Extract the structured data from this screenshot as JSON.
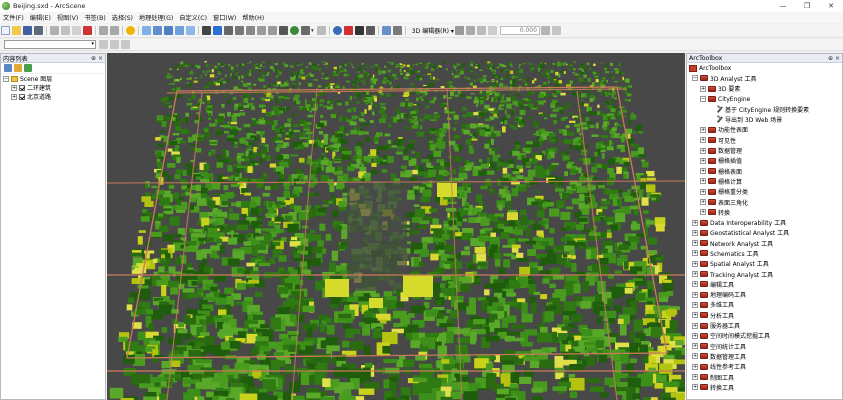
{
  "window": {
    "title": "Beijing.sxd - ArcScene",
    "controls": [
      "—",
      "❒",
      "✕"
    ]
  },
  "menu": [
    "文件(F)",
    "编辑(E)",
    "视图(V)",
    "书签(B)",
    "选择(S)",
    "地理处理(G)",
    "自定义(C)",
    "窗口(W)",
    "帮助(H)"
  ],
  "toolbar": {
    "editor_label": "3D 编辑器(R) ▾",
    "zoom_value": "0.000"
  },
  "toc": {
    "title": "内容列表",
    "controls": "⊕ ×",
    "layers_root": "Scene 图层",
    "layers": [
      "二环建筑",
      "北京道路"
    ]
  },
  "toolbox": {
    "title": "ArcToolbox",
    "controls": "⊕ ×",
    "root": "ArcToolbox",
    "items": [
      {
        "label": "3D Analyst 工具",
        "level": 0,
        "expander": "−",
        "icon": "toolbox"
      },
      {
        "label": "3D 要素",
        "level": 1,
        "expander": "+",
        "icon": "toolbox"
      },
      {
        "label": "CityEngine",
        "level": 1,
        "expander": "−",
        "icon": "toolbox"
      },
      {
        "label": "基于 CityEngine 规则转换要素",
        "level": 2,
        "expander": "",
        "icon": "tool"
      },
      {
        "label": "导出到 3D Web 场景",
        "level": 2,
        "expander": "",
        "icon": "tool"
      },
      {
        "label": "功能性表面",
        "level": 1,
        "expander": "+",
        "icon": "toolbox"
      },
      {
        "label": "可见性",
        "level": 1,
        "expander": "+",
        "icon": "toolbox"
      },
      {
        "label": "数据管理",
        "level": 1,
        "expander": "+",
        "icon": "toolbox"
      },
      {
        "label": "栅格插值",
        "level": 1,
        "expander": "+",
        "icon": "toolbox"
      },
      {
        "label": "栅格表面",
        "level": 1,
        "expander": "+",
        "icon": "toolbox"
      },
      {
        "label": "栅格计算",
        "level": 1,
        "expander": "+",
        "icon": "toolbox"
      },
      {
        "label": "栅格重分类",
        "level": 1,
        "expander": "+",
        "icon": "toolbox"
      },
      {
        "label": "表面三角化",
        "level": 1,
        "expander": "+",
        "icon": "toolbox"
      },
      {
        "label": "转换",
        "level": 1,
        "expander": "+",
        "icon": "toolbox"
      },
      {
        "label": "Data Interoperability 工具",
        "level": 0,
        "expander": "+",
        "icon": "toolbox"
      },
      {
        "label": "Geostatistical Analyst 工具",
        "level": 0,
        "expander": "+",
        "icon": "toolbox"
      },
      {
        "label": "Network Analyst 工具",
        "level": 0,
        "expander": "+",
        "icon": "toolbox"
      },
      {
        "label": "Schematics 工具",
        "level": 0,
        "expander": "+",
        "icon": "toolbox"
      },
      {
        "label": "Spatial Analyst 工具",
        "level": 0,
        "expander": "+",
        "icon": "toolbox"
      },
      {
        "label": "Tracking Analyst 工具",
        "level": 0,
        "expander": "+",
        "icon": "toolbox"
      },
      {
        "label": "编辑工具",
        "level": 0,
        "expander": "+",
        "icon": "toolbox"
      },
      {
        "label": "地理编码工具",
        "level": 0,
        "expander": "+",
        "icon": "toolbox"
      },
      {
        "label": "多维工具",
        "level": 0,
        "expander": "+",
        "icon": "toolbox"
      },
      {
        "label": "分析工具",
        "level": 0,
        "expander": "+",
        "icon": "toolbox"
      },
      {
        "label": "服务器工具",
        "level": 0,
        "expander": "+",
        "icon": "toolbox"
      },
      {
        "label": "空间时间模式挖掘工具",
        "level": 0,
        "expander": "+",
        "icon": "toolbox"
      },
      {
        "label": "空间统计工具",
        "level": 0,
        "expander": "+",
        "icon": "toolbox"
      },
      {
        "label": "数据管理工具",
        "level": 0,
        "expander": "+",
        "icon": "toolbox"
      },
      {
        "label": "线性参考工具",
        "level": 0,
        "expander": "+",
        "icon": "toolbox"
      },
      {
        "label": "制图工具",
        "level": 0,
        "expander": "+",
        "icon": "toolbox"
      },
      {
        "label": "转换工具",
        "level": 0,
        "expander": "+",
        "icon": "toolbox"
      }
    ]
  },
  "colors": {
    "scene_background": "#484848",
    "building_green": "#2f7a12",
    "building_highlight": "#c8d21a",
    "road": "#c97a5a"
  }
}
